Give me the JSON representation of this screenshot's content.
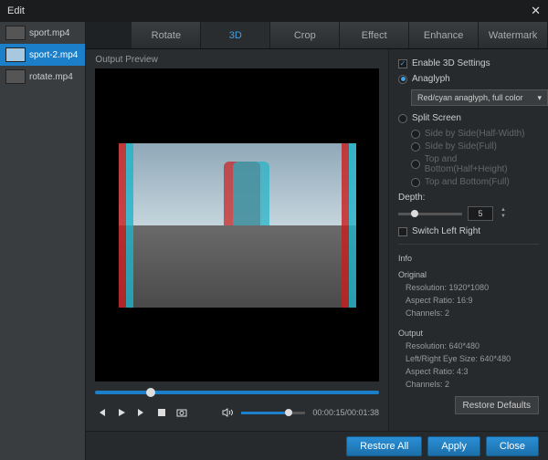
{
  "window": {
    "title": "Edit"
  },
  "sidebar": {
    "files": [
      {
        "name": "sport.mp4",
        "selected": false
      },
      {
        "name": "sport-2.mp4",
        "selected": true
      },
      {
        "name": "rotate.mp4",
        "selected": false
      }
    ]
  },
  "tabs": [
    "Rotate",
    "3D",
    "Crop",
    "Effect",
    "Enhance",
    "Watermark"
  ],
  "active_tab": "3D",
  "preview": {
    "label": "Output Preview"
  },
  "player": {
    "time": "00:00:15/00:01:38"
  },
  "settings": {
    "enable_label": "Enable 3D Settings",
    "enabled": true,
    "mode": "anaglyph",
    "anaglyph_label": "Anaglyph",
    "anaglyph_option": "Red/cyan anaglyph, full color",
    "split_label": "Split Screen",
    "split_options": [
      "Side by Side(Half-Width)",
      "Side by Side(Full)",
      "Top and Bottom(Half+Height)",
      "Top and Bottom(Full)"
    ],
    "depth_label": "Depth:",
    "depth_value": "5",
    "switch_label": "Switch Left Right",
    "switch_on": false
  },
  "info": {
    "header": "Info",
    "original": {
      "label": "Original",
      "resolution": "Resolution: 1920*1080",
      "aspect": "Aspect Ratio: 16:9",
      "channels": "Channels: 2"
    },
    "output": {
      "label": "Output",
      "resolution": "Resolution: 640*480",
      "eye": "Left/Right Eye Size: 640*480",
      "aspect": "Aspect Ratio: 4:3",
      "channels": "Channels: 2"
    }
  },
  "buttons": {
    "restore_defaults": "Restore Defaults",
    "restore_all": "Restore All",
    "apply": "Apply",
    "close": "Close"
  }
}
